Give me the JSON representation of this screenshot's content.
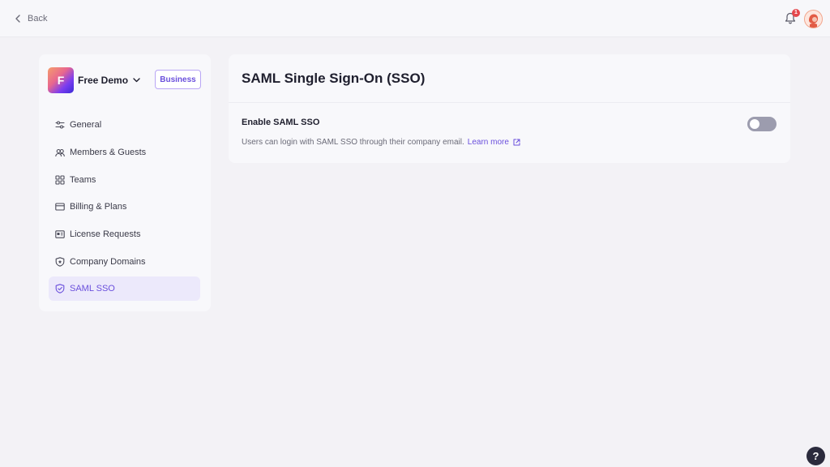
{
  "topbar": {
    "back_label": "Back",
    "notification_count": "1"
  },
  "sidebar": {
    "workspace_initial": "F",
    "workspace_name": "Free Demo",
    "plan": "Business",
    "items": [
      {
        "label": "General",
        "icon": "sliders-icon"
      },
      {
        "label": "Members & Guests",
        "icon": "users-icon"
      },
      {
        "label": "Teams",
        "icon": "grid-icon"
      },
      {
        "label": "Billing & Plans",
        "icon": "credit-card-icon"
      },
      {
        "label": "License Requests",
        "icon": "id-card-icon"
      },
      {
        "label": "Company Domains",
        "icon": "shield-star-icon"
      },
      {
        "label": "SAML SSO",
        "icon": "shield-check-icon",
        "active": true
      }
    ]
  },
  "main": {
    "title": "SAML Single Sign-On (SSO)",
    "setting_label": "Enable SAML SSO",
    "setting_description": "Users can login with SAML SSO through their company email.",
    "learn_more": "Learn more",
    "toggle_enabled": false
  },
  "help_label": "?",
  "colors": {
    "accent": "#6a4fdc",
    "active_bg": "#ece9fb",
    "toggle_off": "#9c9cae",
    "badge_red": "#e5484d"
  }
}
